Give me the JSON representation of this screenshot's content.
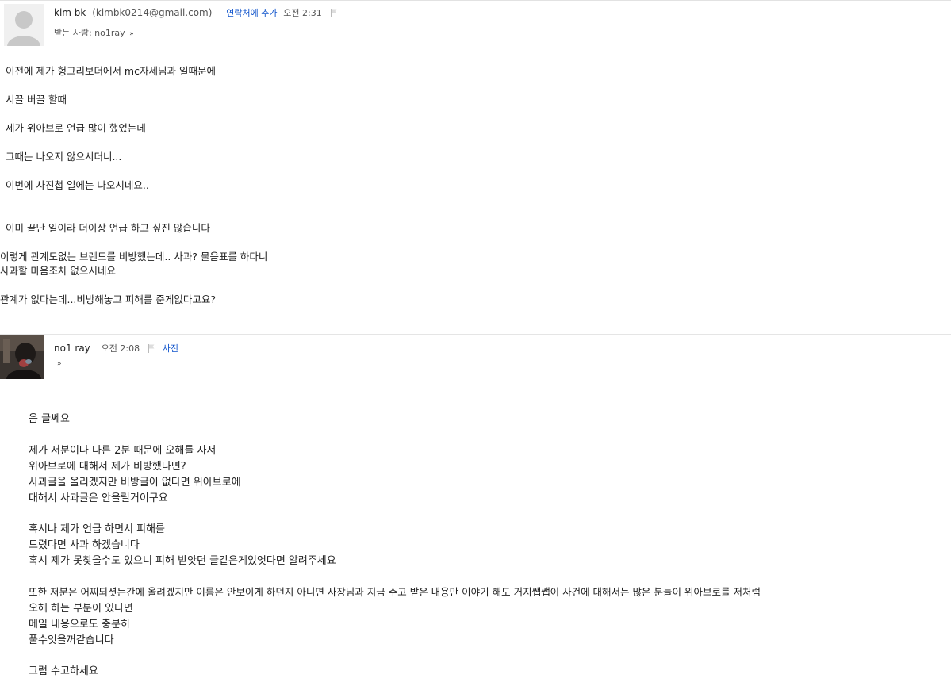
{
  "message1": {
    "sender_name": "kim bk",
    "sender_email": "(kimbk0214@gmail.com)",
    "add_contact": "연락처에 추가",
    "time": "오전 2:31",
    "to_label": "받는 사람: no1ray",
    "body": [
      "이전에 제가 헝그리보더에서 mc자세님과 일때문에",
      "시끌 버끌 할때",
      "제가 위아브로 언급 많이 했었는데",
      "그때는 나오지 않으시더니...",
      "이번에 사진첩 일에는 나오시네요..",
      "이미 끝난 일이라 더이상 언급 하고 싶진 않습니다",
      "이렇게 관계도없는 브랜드를 비방했는데.. 사과? 물음표를 하다니",
      "사과할 마음조차 없으시네요",
      "관계가 없다는데...비방해놓고 피해를 준게없다고요?"
    ]
  },
  "message2": {
    "sender_name": "no1 ray",
    "time": "오전 2:08",
    "attachment_label": "사진",
    "body": [
      "음 글쎄요",
      "제가 저분이나 다른 2분 때문에 오해를 사서",
      "위아브로에 대해서 제가 비방했다면?",
      "사과글을 올리겠지만 비방글이 없다면 위아브로에",
      "대해서 사과글은 안올릴거이구요",
      "혹시나 제가 언급 하면서 피해를",
      "드렸다면 사과 하겠습니다",
      "혹시 제가 못찾을수도 있으니 피해 받앗던 글같은게있엇다면 알려주세요",
      "또한 저분은 어찌되셧든간에 올려겠지만 이름은 안보이게 하던지 아니면 사장님과 지금 주고 받은 내용만 이야기 해도 거지쌥쌥이 사건에 대해서는 많은 분들이 위아브로를 저처럼",
      "오해 하는 부분이 있다면",
      "메일 내용으로도 충분히",
      "풀수잇을꺼같습니다",
      "그럼 수고하세요"
    ]
  },
  "icons": {
    "chevron": "double-chevron-down-icon",
    "flag": "flag-icon",
    "avatar_default": "default-avatar-icon"
  },
  "colors": {
    "link": "#1155cc",
    "text": "#222222",
    "muted": "#555555"
  }
}
